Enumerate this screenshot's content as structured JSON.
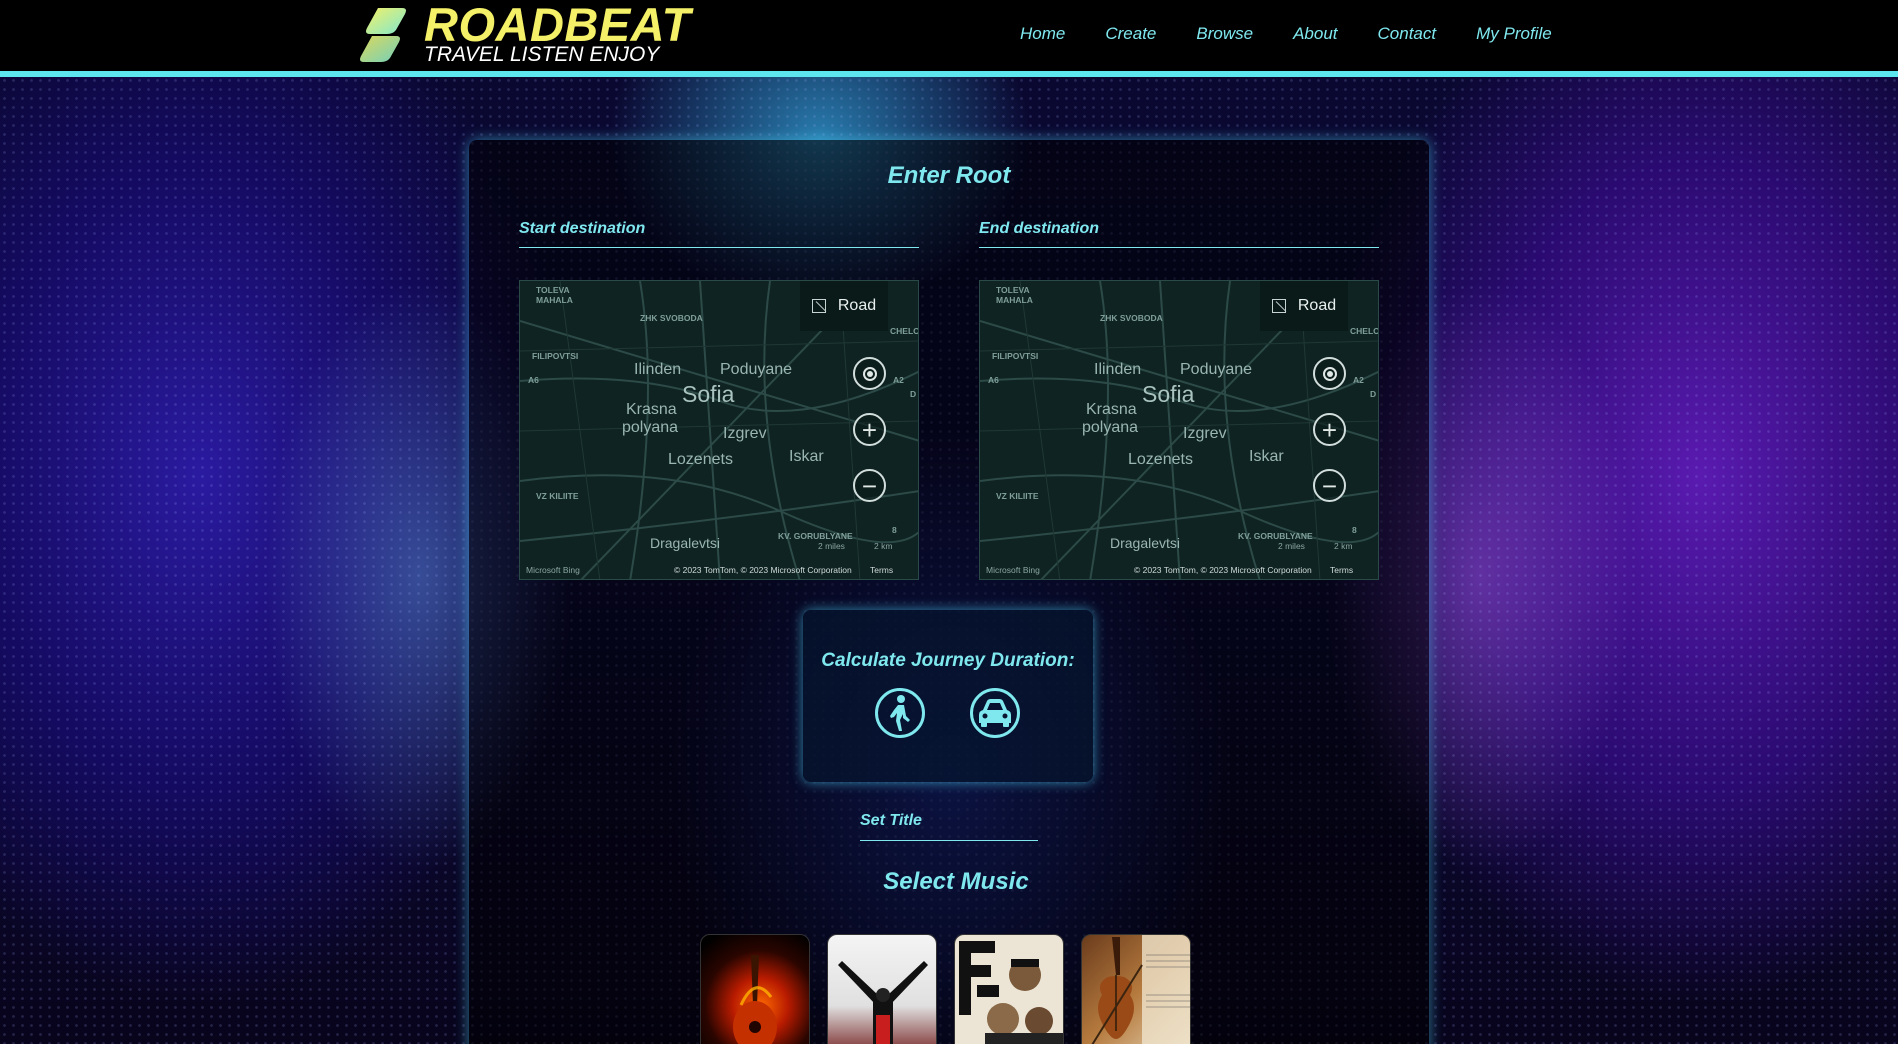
{
  "brand": {
    "name": "ROADBEAT",
    "tagline": "TRAVEL LISTEN ENJOY"
  },
  "nav": [
    "Home",
    "Create",
    "Browse",
    "About",
    "Contact",
    "My Profile"
  ],
  "colors": {
    "accent": "#7fe8ef",
    "brand_yellow": "#f4f067",
    "header_bg": "#000000"
  },
  "form": {
    "title": "Enter Root",
    "start_label": "Start destination",
    "end_label": "End destination",
    "set_title_label": "Set Title"
  },
  "map": {
    "style_button": "Road",
    "labels": {
      "city": "Sofia",
      "ilinden": "Ilinden",
      "poduyane": "Poduyane",
      "krasna": "Krasna",
      "polyana": "polyana",
      "izgrev": "Izgrev",
      "lozenets": "Lozenets",
      "iskar": "Iskar",
      "dragalevtsi": "Dragalevtsi",
      "toleva": "TOLEVA",
      "mahala": "MAHALA",
      "zhk": "ZHK SVOBODA",
      "filipovtsi": "FILIPOVTSI",
      "vz": "VZ KILIITE",
      "kv1": "KV. GORUBLYANE",
      "chelop": "CHELOP",
      "a6": "A6",
      "a2": "A2",
      "d": "D",
      "eight": "8"
    },
    "scale_miles": "2 miles",
    "scale_km": "2 km",
    "logo": "Microsoft Bing",
    "copyright": "© 2023 TomTom, © 2023 Microsoft Corporation",
    "terms": "Terms"
  },
  "journey": {
    "title": "Calculate Journey Duration:",
    "modes": [
      "walk-icon",
      "car-icon"
    ]
  },
  "music": {
    "title": "Select Music",
    "albums": [
      "rock-guitar-album",
      "pop-album",
      "hiphop-album",
      "classical-violin-album"
    ]
  }
}
